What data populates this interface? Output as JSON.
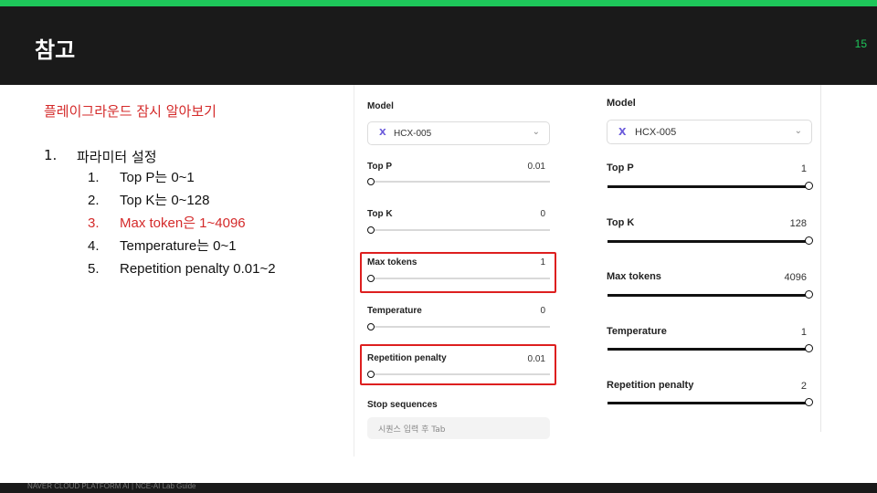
{
  "header": {
    "title": "참고",
    "page_number": "15"
  },
  "footer": {
    "text": "NAVER CLOUD PLATFORM AI | NCE-AI Lab Guide"
  },
  "content": {
    "subtitle": "플레이그라운드 잠시 알아보기",
    "list": {
      "num": "1.",
      "label": "파라미터 설정",
      "items": [
        {
          "num": "1.",
          "text": "Top P는 0~1"
        },
        {
          "num": "2.",
          "text": "Top K는 0~128"
        },
        {
          "num": "3.",
          "text": "Max token은 1~4096"
        },
        {
          "num": "4.",
          "text": "Temperature는 0~1"
        },
        {
          "num": "5.",
          "text": "Repetition penalty 0.01~2"
        }
      ]
    }
  },
  "panel_min": {
    "model_label": "Model",
    "model_value": "HCX-005",
    "params": [
      {
        "label": "Top P",
        "value": "0.01",
        "level": 0
      },
      {
        "label": "Top K",
        "value": "0",
        "level": 0
      },
      {
        "label": "Max tokens",
        "value": "1",
        "level": 0
      },
      {
        "label": "Temperature",
        "value": "0",
        "level": 0
      },
      {
        "label": "Repetition penalty",
        "value": "0.01",
        "level": 0
      }
    ],
    "stop_sequences_label": "Stop sequences",
    "stop_sequences_placeholder": "시퀀스 입력 후 Tab"
  },
  "panel_max": {
    "model_label": "Model",
    "model_value": "HCX-005",
    "params": [
      {
        "label": "Top P",
        "value": "1",
        "level": 1
      },
      {
        "label": "Top K",
        "value": "128",
        "level": 1
      },
      {
        "label": "Max tokens",
        "value": "4096",
        "level": 1
      },
      {
        "label": "Temperature",
        "value": "1",
        "level": 1
      },
      {
        "label": "Repetition penalty",
        "value": "2",
        "level": 1
      }
    ]
  },
  "colors": {
    "accent": "#1ec75a",
    "highlight": "#d42a2a",
    "header_bg": "#1a1a1a",
    "model_icon": "#6b5bdb"
  },
  "icons": {
    "model": "model-x-icon",
    "dropdown": "chevron-down-icon",
    "slider": "slider-knob"
  }
}
